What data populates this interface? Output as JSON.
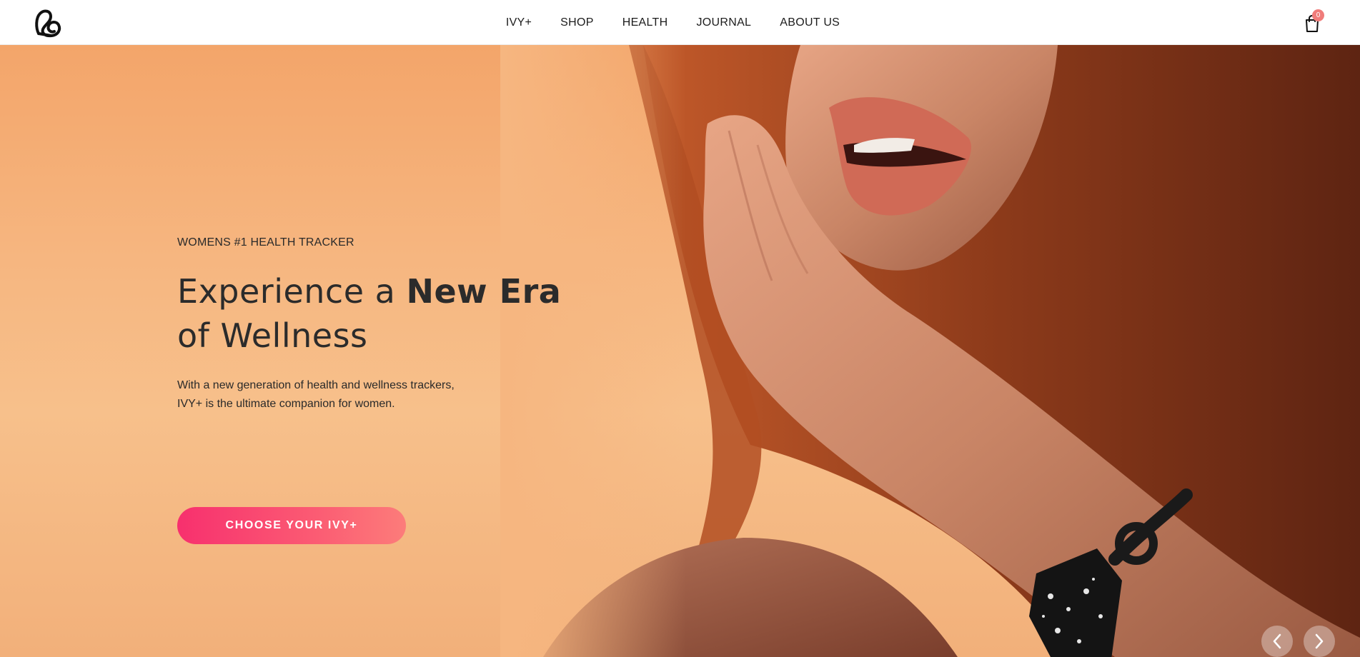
{
  "header": {
    "logo_icon": "ivy-heart-logo-icon",
    "nav": [
      {
        "label": "IVY+"
      },
      {
        "label": "SHOP"
      },
      {
        "label": "HEALTH"
      },
      {
        "label": "JOURNAL"
      },
      {
        "label": "ABOUT US"
      }
    ],
    "cart": {
      "icon": "shopping-bag-icon",
      "count": "0",
      "badge_color": "#f07c7a"
    }
  },
  "hero": {
    "eyebrow": "WOMENS #1 HEALTH TRACKER",
    "headline": {
      "part1": "Experience a ",
      "part2_bold": "New Era",
      "part3": "of Wellness"
    },
    "subtext_line1": "With a new generation of health and wellness trackers,",
    "subtext_line2": "IVY+ is the ultimate companion for women.",
    "cta_label": "CHOOSE YOUR IVY+",
    "colors": {
      "background": "#f6b680",
      "cta_start": "#f7306e",
      "cta_end": "#fc7c7a",
      "text": "#2b2b2b"
    },
    "carousel": {
      "prev_icon": "chevron-left-icon",
      "next_icon": "chevron-right-icon"
    }
  }
}
